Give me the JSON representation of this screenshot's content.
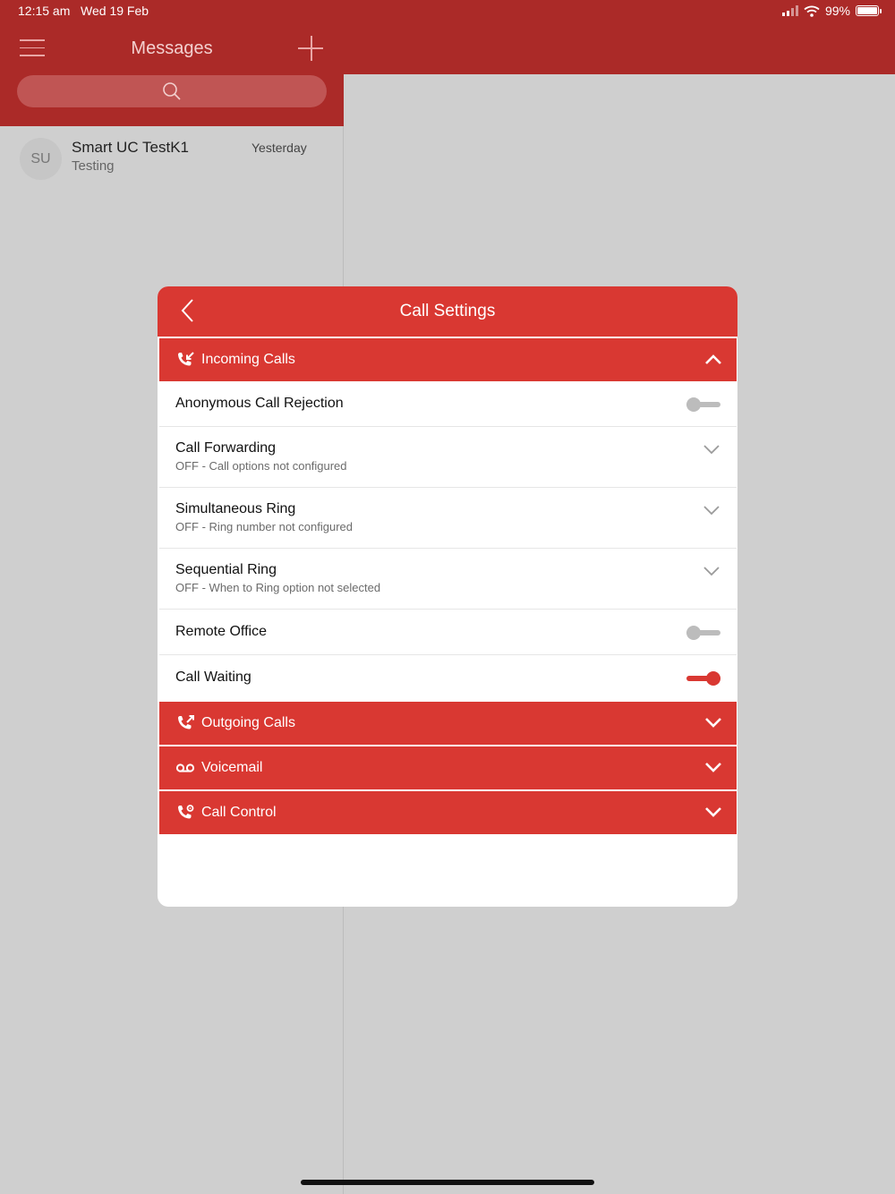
{
  "status_bar": {
    "time": "12:15 am",
    "date": "Wed 19 Feb",
    "battery": "99%"
  },
  "messages": {
    "title": "Messages",
    "conversations": [
      {
        "initials": "SU",
        "name": "Smart UC TestK1",
        "preview": "Testing",
        "time": "Yesterday"
      }
    ]
  },
  "call_settings": {
    "title": "Call Settings",
    "incoming": {
      "label": "Incoming Calls",
      "rows": [
        {
          "label": "Anonymous Call Rejection",
          "sub": "",
          "control": "toggle",
          "on": false
        },
        {
          "label": "Call Forwarding",
          "sub": "OFF - Call options not configured",
          "control": "chevron"
        },
        {
          "label": "Simultaneous Ring",
          "sub": "OFF - Ring number not configured",
          "control": "chevron"
        },
        {
          "label": "Sequential Ring",
          "sub": "OFF - When to Ring option not selected",
          "control": "chevron"
        },
        {
          "label": "Remote Office",
          "sub": "",
          "control": "toggle",
          "on": false
        },
        {
          "label": "Call Waiting",
          "sub": "",
          "control": "toggle",
          "on": true
        }
      ]
    },
    "outgoing": {
      "label": "Outgoing Calls"
    },
    "voicemail": {
      "label": "Voicemail"
    },
    "call_control": {
      "label": "Call Control"
    }
  },
  "colors": {
    "header_dark": "#ab2a28",
    "accent": "#d93832",
    "background": "#cfcfcf"
  }
}
